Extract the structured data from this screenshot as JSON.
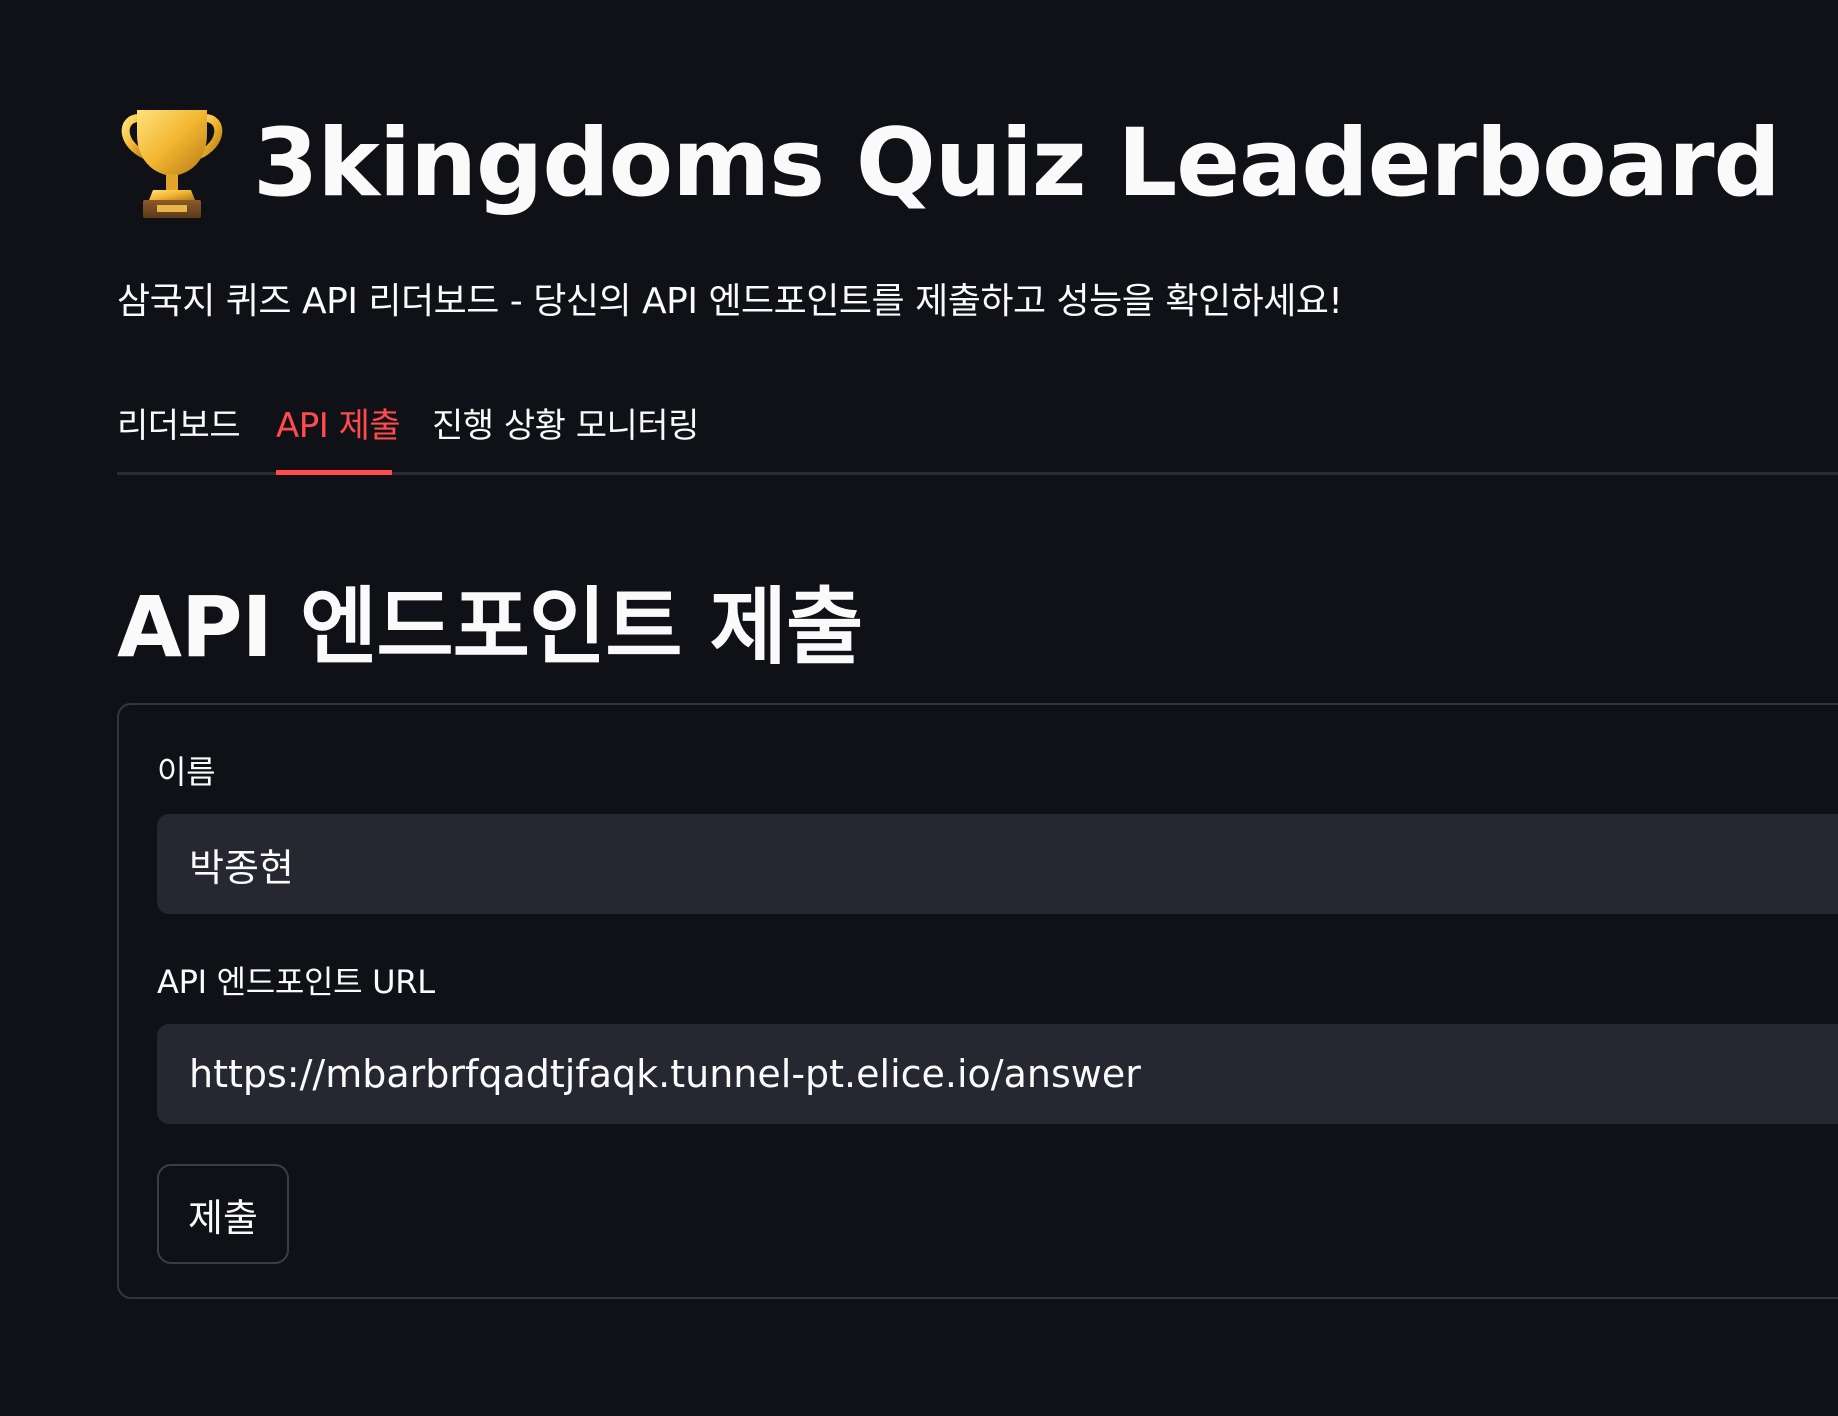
{
  "header": {
    "icon": "trophy-icon",
    "title": "3kingdoms Quiz Leaderboard",
    "subtitle": "삼국지 퀴즈 API 리더보드 - 당신의 API 엔드포인트를 제출하고 성능을 확인하세요!"
  },
  "tabs": [
    {
      "label": "리더보드",
      "active": false
    },
    {
      "label": "API 제출",
      "active": true
    },
    {
      "label": "진행 상황 모니터링",
      "active": false
    }
  ],
  "colors": {
    "background": "#0f1117",
    "accent": "#ff4b4b",
    "input_background": "#262730",
    "text": "#fafafa"
  },
  "main": {
    "heading": "API 엔드포인트 제출",
    "form": {
      "name_label": "이름",
      "name_value": "박종현",
      "url_label": "API 엔드포인트 URL",
      "url_value": "https://mbarbrfqadtjfaqk.tunnel-pt.elice.io/answer",
      "submit_label": "제출"
    }
  }
}
